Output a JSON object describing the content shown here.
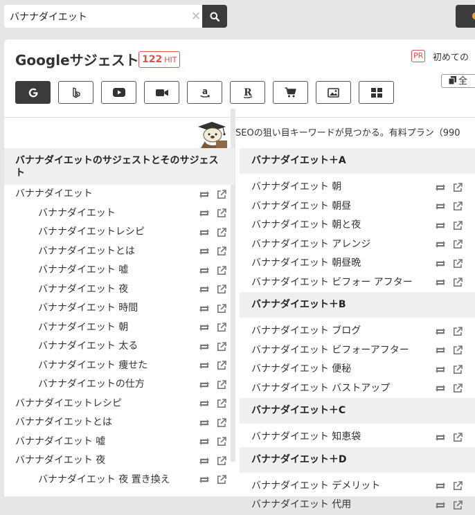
{
  "search": {
    "value": "バナナダイエット",
    "clear": "✕"
  },
  "title": "Googleサジェスト",
  "hit": {
    "count": "122",
    "unit": "HIT"
  },
  "pr": {
    "badge": "PR",
    "text": "初めての"
  },
  "copy_label": "全",
  "engines": [
    "google-icon",
    "bing-icon",
    "youtube-icon",
    "video-camera-icon",
    "amazon-icon",
    "rakuten-icon",
    "cart-icon",
    "image-icon",
    "apps-icon"
  ],
  "promo": "SEOの狙い目キーワードが見つかる。有料プラン（990",
  "left": {
    "header": "バナナダイエットのサジェストとそのサジェスト",
    "rows": [
      {
        "text": "バナナダイエット",
        "sub": false
      },
      {
        "text": "バナナダイエット",
        "sub": true
      },
      {
        "text": "バナナダイエットレシピ",
        "sub": true
      },
      {
        "text": "バナナダイエットとは",
        "sub": true
      },
      {
        "text": "バナナダイエット 嘘",
        "sub": true
      },
      {
        "text": "バナナダイエット 夜",
        "sub": true
      },
      {
        "text": "バナナダイエット 時間",
        "sub": true
      },
      {
        "text": "バナナダイエット 朝",
        "sub": true
      },
      {
        "text": "バナナダイエット 太る",
        "sub": true
      },
      {
        "text": "バナナダイエット 痩せた",
        "sub": true
      },
      {
        "text": "バナナダイエットの仕方",
        "sub": true
      },
      {
        "text": "バナナダイエットレシピ",
        "sub": false
      },
      {
        "text": "バナナダイエットとは",
        "sub": false
      },
      {
        "text": "バナナダイエット 嘘",
        "sub": false
      },
      {
        "text": "バナナダイエット 夜",
        "sub": false
      },
      {
        "text": "バナナダイエット 夜 置き換え",
        "sub": true
      }
    ]
  },
  "right": {
    "groups": [
      {
        "header": "バナナダイエット＋A",
        "rows": [
          "バナナダイエット 朝",
          "バナナダイエット 朝昼",
          "バナナダイエット 朝と夜",
          "バナナダイエット アレンジ",
          "バナナダイエット 朝昼晩",
          "バナナダイエット ビフォー アフター"
        ]
      },
      {
        "header": "バナナダイエット＋B",
        "rows": [
          "バナナダイエット ブログ",
          "バナナダイエット ビフォーアフター",
          "バナナダイエット 便秘",
          "バナナダイエット バストアップ"
        ]
      },
      {
        "header": "バナナダイエット＋C",
        "rows": [
          "バナナダイエット 知恵袋"
        ]
      },
      {
        "header": "バナナダイエット＋D",
        "rows": [
          "バナナダイエット デメリット",
          "バナナダイエット 代用"
        ]
      }
    ]
  }
}
